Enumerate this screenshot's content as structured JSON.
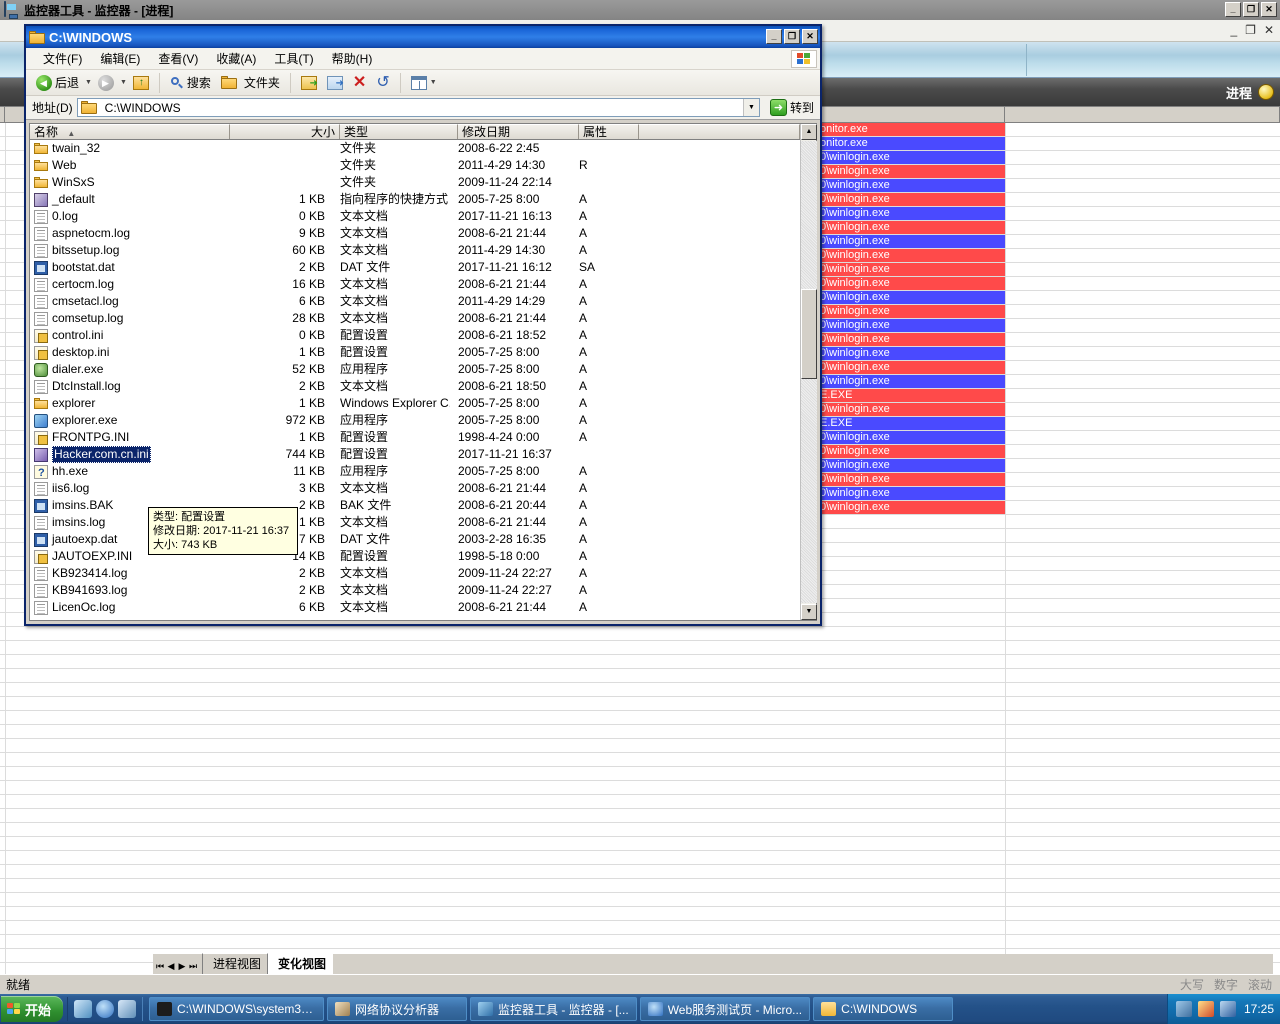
{
  "monitor": {
    "title": "监控器工具 - 监控器 - [进程]",
    "window_buttons": [
      "_",
      "❐",
      "✕"
    ],
    "mdi_buttons": [
      "_",
      "❐",
      "✕"
    ],
    "header_label": "进程",
    "status_left": "就绪",
    "status_right": [
      "大写",
      "数字",
      "滚动"
    ],
    "tab_nav": [
      "⏮",
      "◀",
      "▶",
      "⏭"
    ],
    "tabs": [
      {
        "label": "进程视图",
        "active": false
      },
      {
        "label": "变化视图",
        "active": true
      }
    ],
    "process_rows": [
      {
        "text": "onitor.exe",
        "color": "#ff4a4a"
      },
      {
        "text": "onitor.exe",
        "color": "#4a4aff"
      },
      {
        "text": "0\\winlogin.exe",
        "color": "#4a4aff"
      },
      {
        "text": "0\\winlogin.exe",
        "color": "#ff4a4a"
      },
      {
        "text": "0\\winlogin.exe",
        "color": "#4a4aff"
      },
      {
        "text": "0\\winlogin.exe",
        "color": "#ff4a4a"
      },
      {
        "text": "0\\winlogin.exe",
        "color": "#4a4aff"
      },
      {
        "text": "0\\winlogin.exe",
        "color": "#ff4a4a"
      },
      {
        "text": "0\\winlogin.exe",
        "color": "#4a4aff"
      },
      {
        "text": "0\\winlogin.exe",
        "color": "#ff4a4a"
      },
      {
        "text": "0\\winlogin.exe",
        "color": "#ff4a4a"
      },
      {
        "text": "0\\winlogin.exe",
        "color": "#ff4a4a"
      },
      {
        "text": "0\\winlogin.exe",
        "color": "#4a4aff"
      },
      {
        "text": "0\\winlogin.exe",
        "color": "#ff4a4a"
      },
      {
        "text": "0\\winlogin.exe",
        "color": "#4a4aff"
      },
      {
        "text": "0\\winlogin.exe",
        "color": "#ff4a4a"
      },
      {
        "text": "0\\winlogin.exe",
        "color": "#4a4aff"
      },
      {
        "text": "0\\winlogin.exe",
        "color": "#ff4a4a"
      },
      {
        "text": "0\\winlogin.exe",
        "color": "#4a4aff"
      },
      {
        "text": "E.EXE",
        "color": "#ff4a4a"
      },
      {
        "text": "0\\winlogin.exe",
        "color": "#ff4a4a"
      },
      {
        "text": "E.EXE",
        "color": "#4a4aff"
      },
      {
        "text": "0\\winlogin.exe",
        "color": "#4a4aff"
      },
      {
        "text": "0\\winlogin.exe",
        "color": "#ff4a4a"
      },
      {
        "text": "0\\winlogin.exe",
        "color": "#4a4aff"
      },
      {
        "text": "0\\winlogin.exe",
        "color": "#ff4a4a"
      },
      {
        "text": "0\\winlogin.exe",
        "color": "#4a4aff"
      },
      {
        "text": "0\\winlogin.exe",
        "color": "#ff4a4a"
      }
    ]
  },
  "explorer": {
    "title": "C:\\WINDOWS",
    "window_buttons": [
      "_",
      "❐",
      "✕"
    ],
    "menu": [
      "文件(F)",
      "编辑(E)",
      "查看(V)",
      "收藏(A)",
      "工具(T)",
      "帮助(H)"
    ],
    "toolbar": {
      "back": "后退",
      "search": "搜索",
      "folders": "文件夹"
    },
    "address": {
      "label": "地址(D)",
      "value": "C:\\WINDOWS",
      "go": "转到"
    },
    "columns": [
      "名称",
      "大小",
      "类型",
      "修改日期",
      "属性"
    ],
    "sort_indicator": "▲",
    "files": [
      {
        "name": "twain_32",
        "icon": "folder",
        "size": "",
        "type": "文件夹",
        "date": "2008-6-22 2:45",
        "attr": ""
      },
      {
        "name": "Web",
        "icon": "folder",
        "size": "",
        "type": "文件夹",
        "date": "2011-4-29 14:30",
        "attr": "R"
      },
      {
        "name": "WinSxS",
        "icon": "folder",
        "size": "",
        "type": "文件夹",
        "date": "2009-11-24 22:14",
        "attr": ""
      },
      {
        "name": "_default",
        "icon": "lnk",
        "size": "1 KB",
        "type": "指向程序的快捷方式",
        "date": "2005-7-25 8:00",
        "attr": "A"
      },
      {
        "name": "0.log",
        "icon": "doc",
        "size": "0 KB",
        "type": "文本文档",
        "date": "2017-11-21 16:13",
        "attr": "A"
      },
      {
        "name": "aspnetocm.log",
        "icon": "doc",
        "size": "9 KB",
        "type": "文本文档",
        "date": "2008-6-21 21:44",
        "attr": "A"
      },
      {
        "name": "bitssetup.log",
        "icon": "doc",
        "size": "60 KB",
        "type": "文本文档",
        "date": "2011-4-29 14:30",
        "attr": "A"
      },
      {
        "name": "bootstat.dat",
        "icon": "dat",
        "size": "2 KB",
        "type": "DAT 文件",
        "date": "2017-11-21 16:12",
        "attr": "SA"
      },
      {
        "name": "certocm.log",
        "icon": "doc",
        "size": "16 KB",
        "type": "文本文档",
        "date": "2008-6-21 21:44",
        "attr": "A"
      },
      {
        "name": "cmsetacl.log",
        "icon": "doc",
        "size": "6 KB",
        "type": "文本文档",
        "date": "2011-4-29 14:29",
        "attr": "A"
      },
      {
        "name": "comsetup.log",
        "icon": "doc",
        "size": "28 KB",
        "type": "文本文档",
        "date": "2008-6-21 21:44",
        "attr": "A"
      },
      {
        "name": "control.ini",
        "icon": "ini",
        "size": "0 KB",
        "type": "配置设置",
        "date": "2008-6-21 18:52",
        "attr": "A"
      },
      {
        "name": "desktop.ini",
        "icon": "ini",
        "size": "1 KB",
        "type": "配置设置",
        "date": "2005-7-25 8:00",
        "attr": "A"
      },
      {
        "name": "dialer.exe",
        "icon": "dialer",
        "size": "52 KB",
        "type": "应用程序",
        "date": "2005-7-25 8:00",
        "attr": "A"
      },
      {
        "name": "DtcInstall.log",
        "icon": "doc",
        "size": "2 KB",
        "type": "文本文档",
        "date": "2008-6-21 18:50",
        "attr": "A"
      },
      {
        "name": "explorer",
        "icon": "folder",
        "size": "1 KB",
        "type": "Windows Explorer C...",
        "date": "2005-7-25 8:00",
        "attr": "A"
      },
      {
        "name": "explorer.exe",
        "icon": "exe",
        "size": "972 KB",
        "type": "应用程序",
        "date": "2005-7-25 8:00",
        "attr": "A"
      },
      {
        "name": "FRONTPG.INI",
        "icon": "ini",
        "size": "1 KB",
        "type": "配置设置",
        "date": "1998-4-24 0:00",
        "attr": "A"
      },
      {
        "name": "Hacker.com.cn.ini",
        "icon": "purple",
        "size": "744 KB",
        "type": "配置设置",
        "date": "2017-11-21 16:37",
        "attr": "",
        "selected": true
      },
      {
        "name": "hh.exe",
        "icon": "hh",
        "size": "11 KB",
        "type": "应用程序",
        "date": "2005-7-25 8:00",
        "attr": "A"
      },
      {
        "name": "iis6.log",
        "icon": "doc",
        "size": "3 KB",
        "type": "文本文档",
        "date": "2008-6-21 21:44",
        "attr": "A"
      },
      {
        "name": "imsins.BAK",
        "icon": "dat",
        "size": "2 KB",
        "type": "BAK 文件",
        "date": "2008-6-21 20:44",
        "attr": "A"
      },
      {
        "name": "imsins.log",
        "icon": "doc",
        "size": "1 KB",
        "type": "文本文档",
        "date": "2008-6-21 21:44",
        "attr": "A"
      },
      {
        "name": "jautoexp.dat",
        "icon": "dat",
        "size": "7 KB",
        "type": "DAT 文件",
        "date": "2003-2-28 16:35",
        "attr": "A"
      },
      {
        "name": "JAUTOEXP.INI",
        "icon": "ini",
        "size": "14 KB",
        "type": "配置设置",
        "date": "1998-5-18 0:00",
        "attr": "A"
      },
      {
        "name": "KB923414.log",
        "icon": "doc",
        "size": "2 KB",
        "type": "文本文档",
        "date": "2009-11-24 22:27",
        "attr": "A"
      },
      {
        "name": "KB941693.log",
        "icon": "doc",
        "size": "2 KB",
        "type": "文本文档",
        "date": "2009-11-24 22:27",
        "attr": "A"
      },
      {
        "name": "LicenOc.log",
        "icon": "doc",
        "size": "6 KB",
        "type": "文本文档",
        "date": "2008-6-21 21:44",
        "attr": "A"
      }
    ],
    "tooltip": {
      "line1": "类型: 配置设置",
      "line2": "修改日期: 2017-11-21 16:37",
      "line3": "大小: 743 KB"
    }
  },
  "taskbar": {
    "start": "开始",
    "quick_launch": [
      "show-desktop-icon",
      "ie-icon",
      "media-icon"
    ],
    "tasks": [
      {
        "label": "C:\\WINDOWS\\system32...",
        "icon": "console-icon"
      },
      {
        "label": "网络协议分析器",
        "icon": "analyzer-icon"
      },
      {
        "label": "监控器工具 - 监控器 - [...",
        "icon": "monitor-icon"
      },
      {
        "label": "Web服务测试页 - Micro...",
        "icon": "ie-icon"
      },
      {
        "label": "C:\\WINDOWS",
        "icon": "folder-icon"
      }
    ],
    "tray_icons": [
      "network-icon",
      "nis-icon",
      "security-icon"
    ],
    "clock": "17:25"
  }
}
